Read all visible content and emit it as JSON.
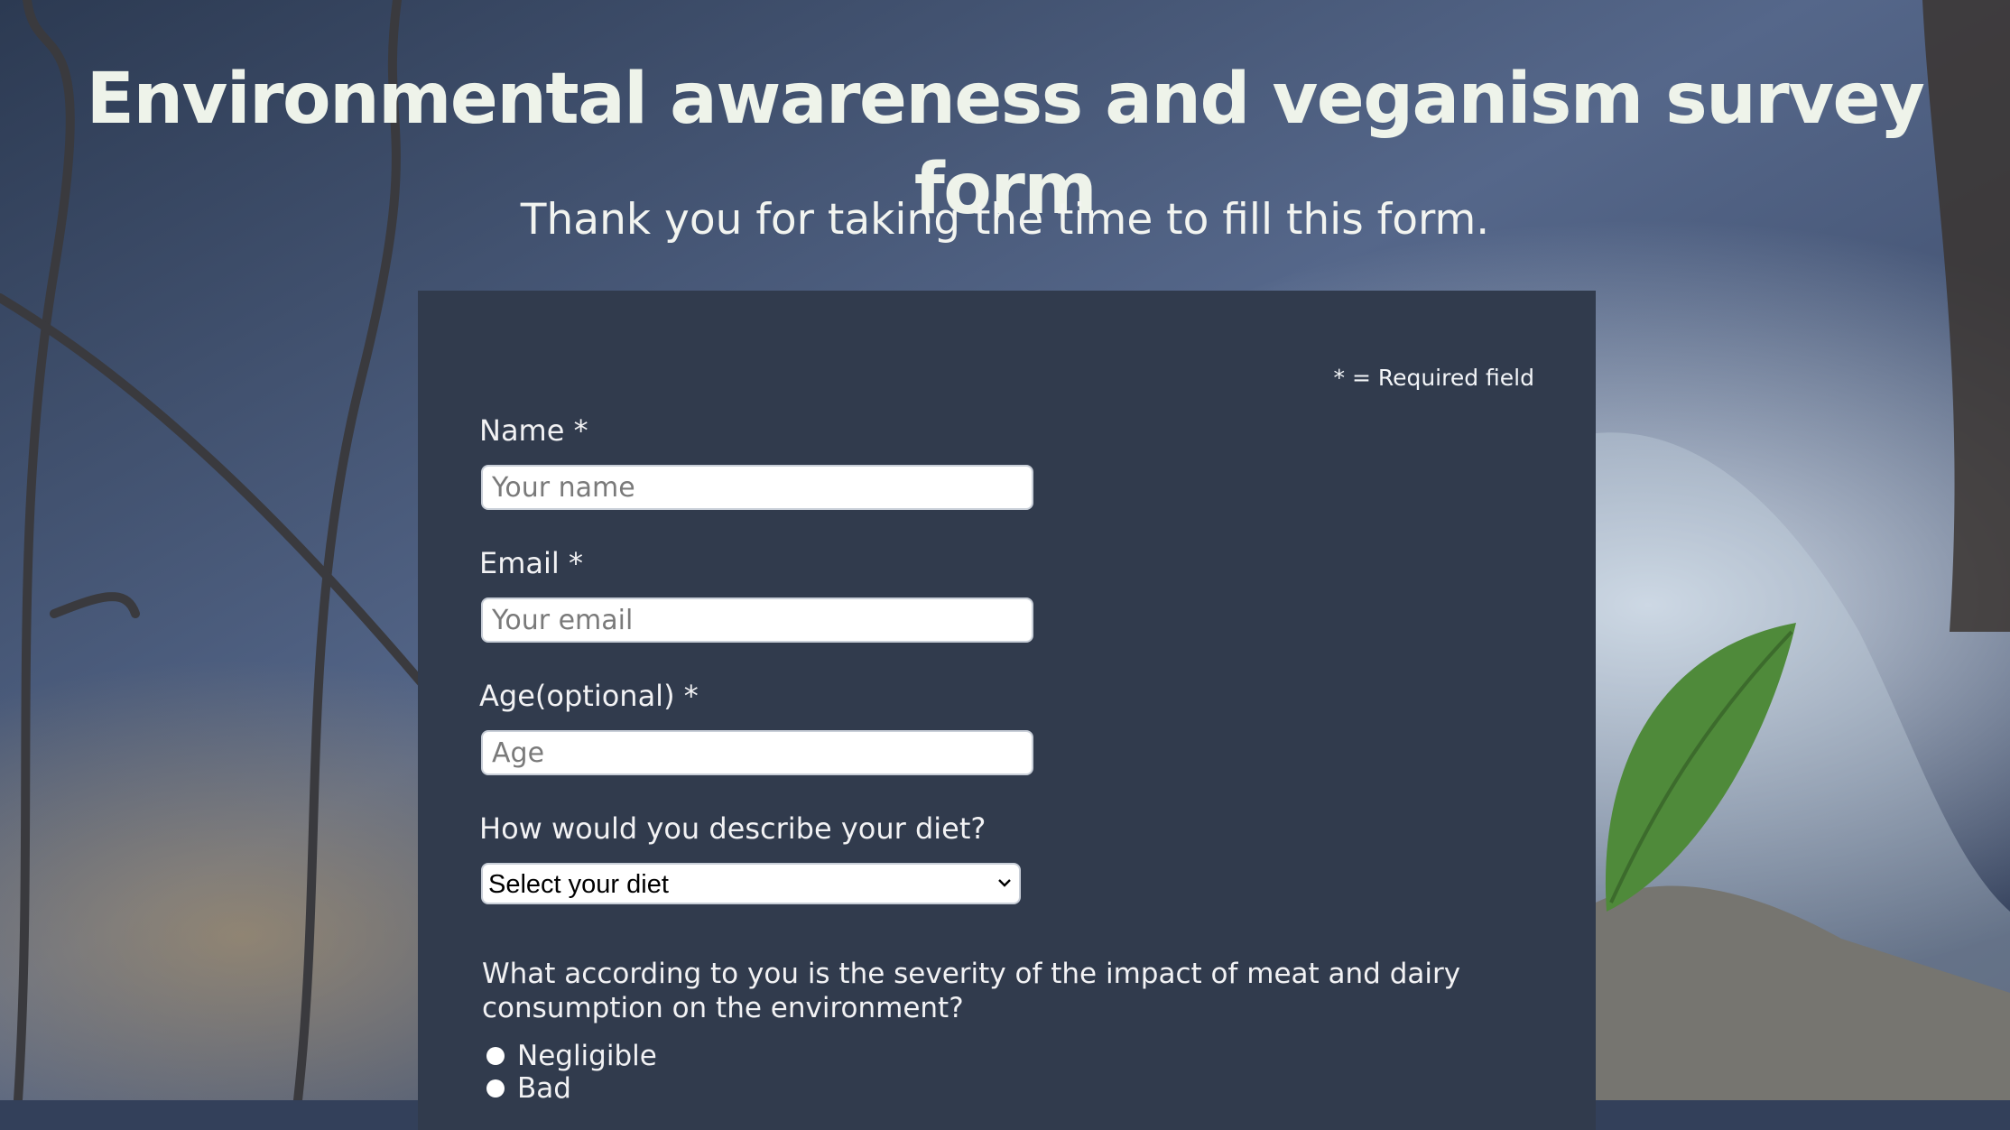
{
  "header": {
    "title": "Environmental awareness and veganism survey form",
    "subtitle": "Thank you for taking the time to fill this form."
  },
  "form": {
    "required_note": "* = Required field",
    "name": {
      "label": "Name *",
      "placeholder": "Your name"
    },
    "email": {
      "label": "Email *",
      "placeholder": "Your email"
    },
    "age": {
      "label": "Age(optional) *",
      "placeholder": "Age"
    },
    "diet": {
      "label": "How would you describe your diet?",
      "selected": "Select your diet"
    },
    "severity": {
      "question": "What according to you is the severity of the impact of meat and dairy consumption on the environment?",
      "options": [
        "Negligible",
        "Bad"
      ]
    }
  },
  "colors": {
    "panel": "#313b4d",
    "title_text": "#eef3ea",
    "input_bg": "#ffffff"
  },
  "icons": {
    "select": "chevron-down-icon",
    "radio": "radio-button"
  }
}
